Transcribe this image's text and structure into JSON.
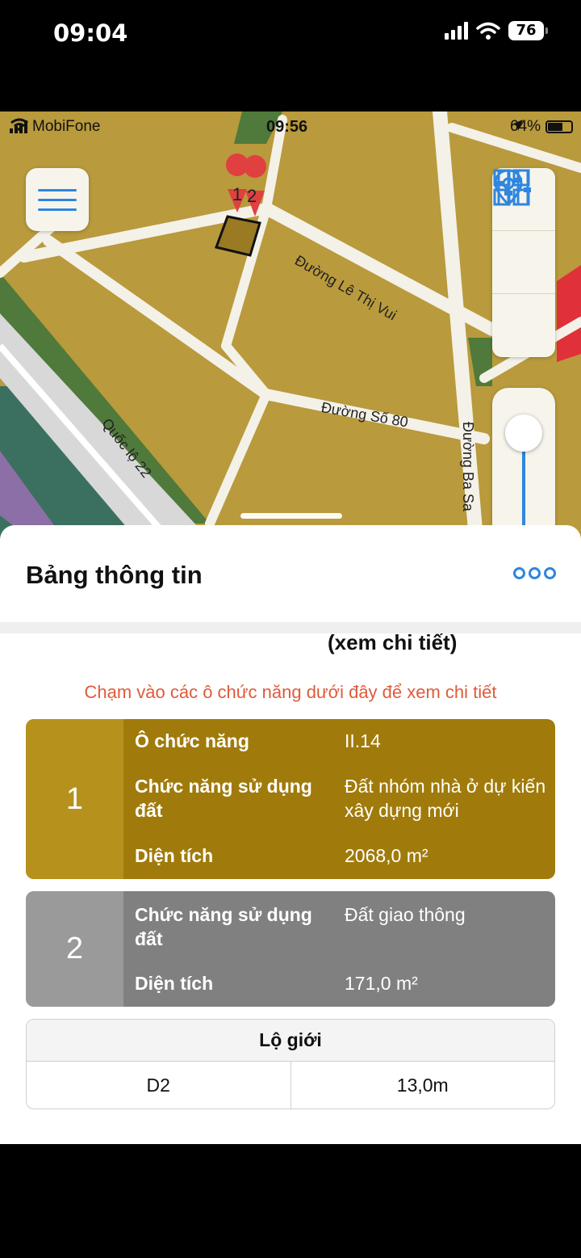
{
  "outer_status": {
    "time": "09:04",
    "battery": "76"
  },
  "inner_status": {
    "carrier": "MobiFone",
    "time": "09:56",
    "battery": "64%"
  },
  "map": {
    "roads": [
      "Đường Lê Thị Vui",
      "Đường Số 80",
      "Quốc lộ 22",
      "Đường Ba Sa"
    ],
    "markers": [
      "1",
      "2"
    ]
  },
  "icons": {
    "menu": "hamburger-icon",
    "layers": "grid-icon",
    "location": "location-pin-icon",
    "filter": "sliders-icon",
    "more": "more-dots-icon"
  },
  "colors": {
    "accent": "#2e86de",
    "parcel_residential": "#a07b0b",
    "parcel_traffic": "#808080",
    "hint": "#e05a3a"
  },
  "sheet": {
    "title": "Bảng thông tin",
    "see_detail": "(xem chi tiết)",
    "hint": "Chạm vào các ô chức năng dưới đây để xem chi tiết"
  },
  "cards": [
    {
      "number": "1",
      "rows": [
        {
          "label": "Ô chức năng",
          "value": "II.14"
        },
        {
          "label": "Chức năng sử dụng đất",
          "value": "Đất nhóm nhà ở dự kiến xây dựng mới"
        },
        {
          "label": "Diện tích",
          "value": "2068,0 m²"
        }
      ]
    },
    {
      "number": "2",
      "rows": [
        {
          "label": "Chức năng sử dụng đất",
          "value": "Đất giao thông"
        },
        {
          "label": "Diện tích",
          "value": "171,0 m²"
        }
      ]
    }
  ],
  "road_width": {
    "header": "Lộ giới",
    "rows": [
      {
        "name": "D2",
        "width": "13,0m"
      }
    ]
  }
}
